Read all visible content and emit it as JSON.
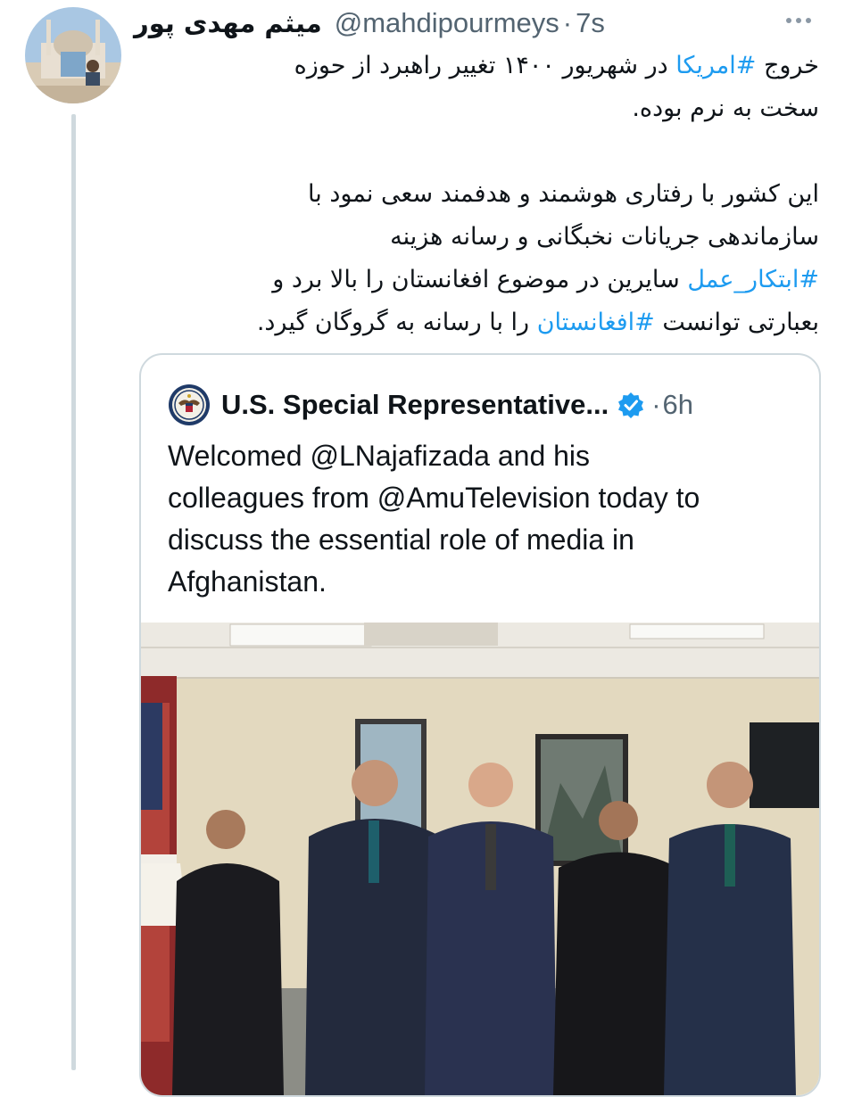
{
  "tweet": {
    "display_name": "میثم مهدی پور",
    "handle": "@mahdipourmeys",
    "separator": "·",
    "time": "7s",
    "lines": [
      [
        {
          "t": "خروج "
        },
        {
          "t": "#امریکا",
          "tag": true
        },
        {
          "t": " در شهریور ۱۴۰۰ تغییر راهبرد از حوزه"
        }
      ],
      [
        {
          "t": "سخت به نرم بوده."
        }
      ],
      [],
      [
        {
          "t": "این کشور با رفتاری هوشمند و هدفمند سعی نمود با"
        }
      ],
      [
        {
          "t": "سازماندهی جریانات نخبگانی و رسانه هزینه"
        }
      ],
      [
        {
          "t": "#ابتکار_عمل",
          "tag": true
        },
        {
          "t": " سایرین در موضوع افغانستان را بالا برد و"
        }
      ],
      [
        {
          "t": "بعبارتی توانست "
        },
        {
          "t": "#افغانستان",
          "tag": true
        },
        {
          "t": " را با رسانه به گروگان گیرد."
        }
      ]
    ]
  },
  "quoted": {
    "display_name": "U.S. Special Representative...",
    "separator": "·",
    "time": "6h",
    "text_lines": [
      "Welcomed @LNajafizada and his",
      "colleagues from @AmuTelevision today to",
      "discuss the essential role of media in",
      "Afghanistan."
    ]
  },
  "icons": {
    "more": "more-horizontal-icon",
    "verified": "verified-badge-icon",
    "logo": "state-department-seal-icon"
  },
  "colors": {
    "link": "#1d9bf0",
    "text": "#0f1419",
    "secondary": "#536471",
    "border": "#cfd9de"
  }
}
